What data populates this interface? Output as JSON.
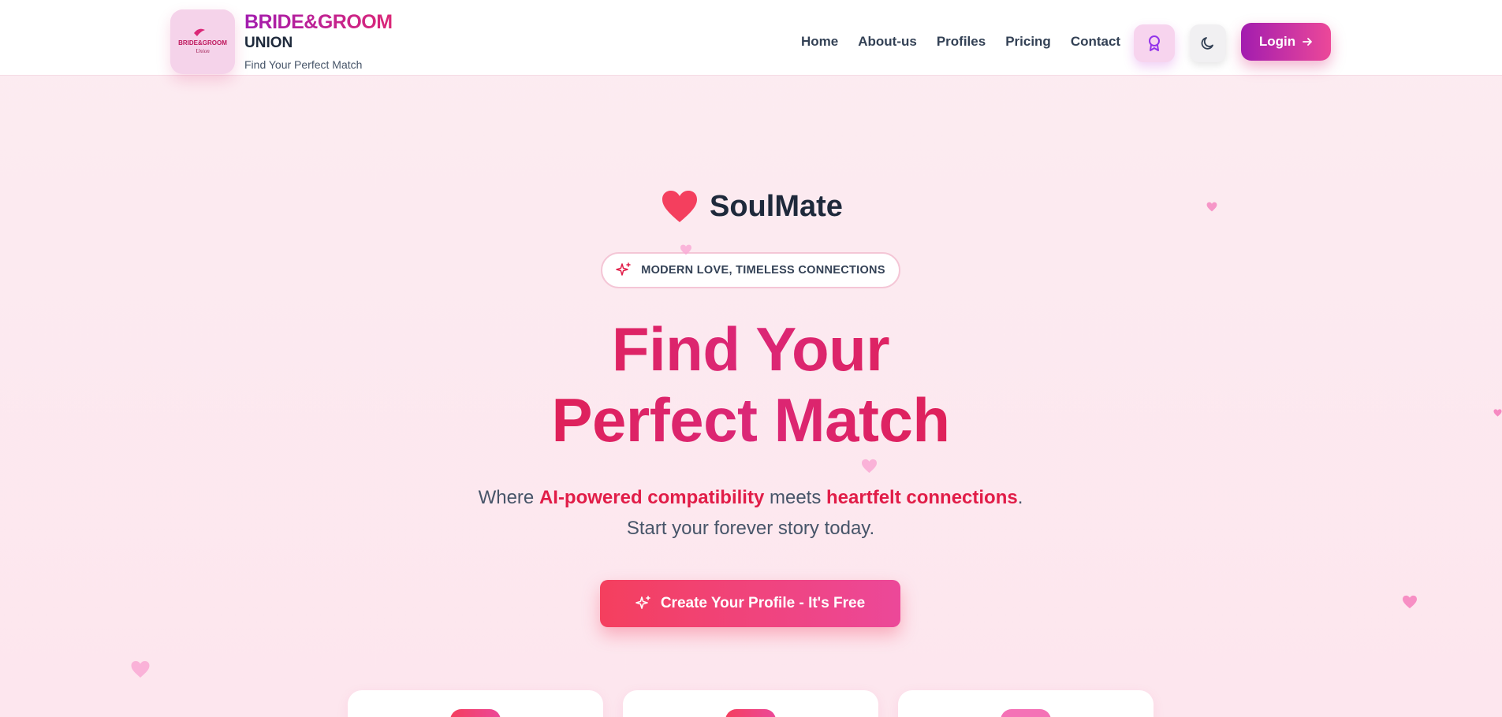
{
  "header": {
    "logo_alt": "Bride & Groom Union logo",
    "brand_title": "BRIDE&GROOM",
    "brand_sub": "UNION",
    "brand_tagline": "Find Your Perfect Match",
    "nav": [
      "Home",
      "About-us",
      "Profiles",
      "Pricing",
      "Contact"
    ],
    "award_icon": "award-icon",
    "theme_icon": "moon-icon",
    "login_label": "Login"
  },
  "hero": {
    "brand": "SoulMate",
    "pill_text": "MODERN LOVE, TIMELESS CONNECTIONS",
    "headline_line1": "Find Your",
    "headline_line2": "Perfect Match",
    "subtitle_pre": "Where ",
    "subtitle_hl1": "AI-powered compatibility",
    "subtitle_mid": " meets ",
    "subtitle_hl2": "heartfelt connections",
    "subtitle_post": ".",
    "subtitle_line2": "Start your forever story today.",
    "cta_label": "Create Your Profile - It's Free"
  },
  "colors": {
    "accent": "#e11d48",
    "brand_gradient_start": "#a21caf",
    "brand_gradient_end": "#ec4899",
    "background": "#fdeaf0"
  }
}
